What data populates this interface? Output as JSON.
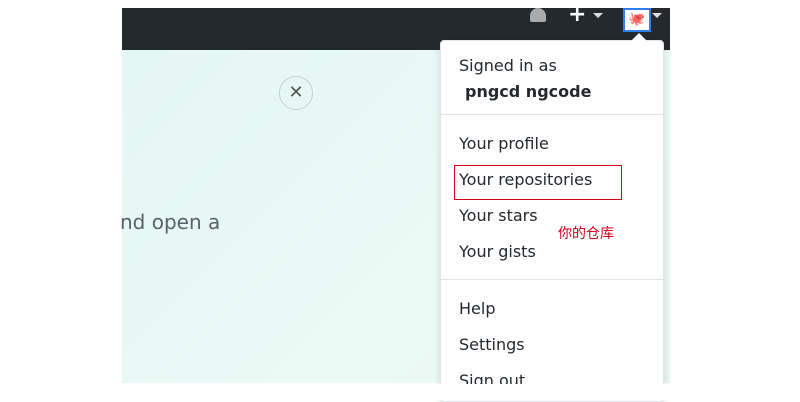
{
  "header": {
    "plus_label": "+",
    "avatar_icon": "octocat-avatar"
  },
  "banner": {
    "close_label": "✕",
    "text": "nd open a"
  },
  "menu": {
    "signed_in_label": "Signed in as",
    "username": "pngcd ngcode",
    "items": [
      "Your profile",
      "Your repositories",
      "Your stars",
      "Your gists",
      "Help",
      "Settings",
      "Sign out"
    ]
  },
  "annotation": {
    "text": "你的仓库",
    "color": "#d0021b"
  }
}
